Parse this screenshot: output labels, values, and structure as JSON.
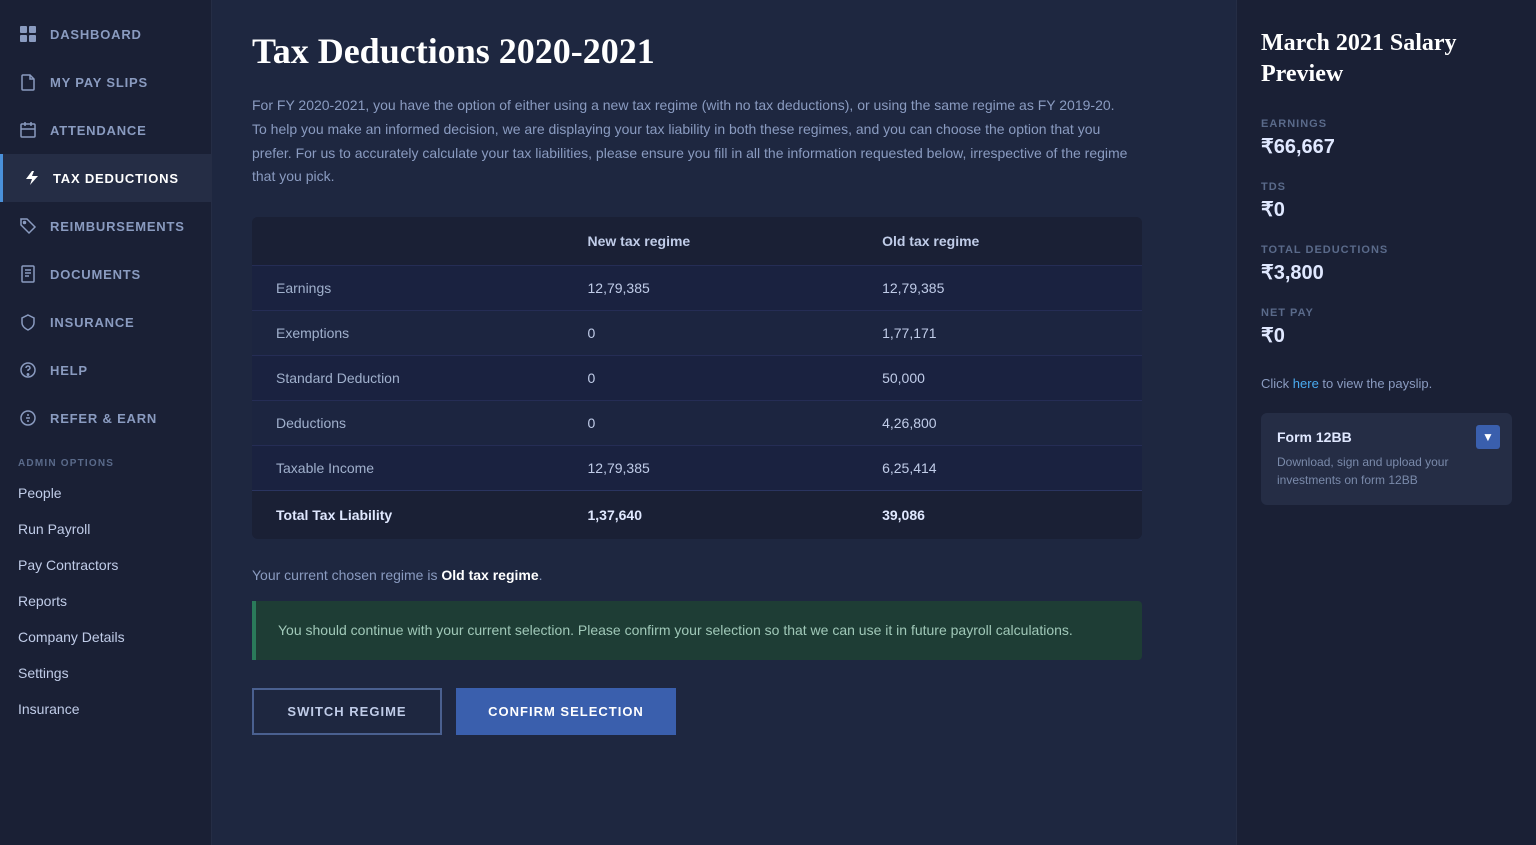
{
  "sidebar": {
    "nav_items": [
      {
        "id": "dashboard",
        "label": "DASHBOARD",
        "icon": "grid"
      },
      {
        "id": "my-pay-slips",
        "label": "MY PAY SLIPS",
        "icon": "file"
      },
      {
        "id": "attendance",
        "label": "ATTENDANCE",
        "icon": "calendar"
      },
      {
        "id": "tax-deductions",
        "label": "TAX DEDUCTIONS",
        "icon": "bolt",
        "active": true
      },
      {
        "id": "reimbursements",
        "label": "REIMBURSEMENTS",
        "icon": "tag"
      },
      {
        "id": "documents",
        "label": "DOCUMENTS",
        "icon": "doc"
      },
      {
        "id": "insurance",
        "label": "INSURANCE",
        "icon": "shield"
      },
      {
        "id": "help",
        "label": "HELP",
        "icon": "question"
      },
      {
        "id": "refer-earn",
        "label": "REFER & EARN",
        "icon": "coin"
      }
    ],
    "admin_section_label": "ADMIN OPTIONS",
    "admin_items": [
      {
        "id": "people",
        "label": "People"
      },
      {
        "id": "run-payroll",
        "label": "Run Payroll"
      },
      {
        "id": "pay-contractors",
        "label": "Pay Contractors"
      },
      {
        "id": "reports",
        "label": "Reports"
      },
      {
        "id": "company-details",
        "label": "Company Details"
      },
      {
        "id": "settings",
        "label": "Settings"
      },
      {
        "id": "insurance-admin",
        "label": "Insurance"
      }
    ]
  },
  "main": {
    "title": "Tax Deductions 2020-2021",
    "description": "For FY 2020-2021, you have the option of either using a new tax regime (with no tax deductions), or using the same regime as FY 2019-20. To help you make an informed decision, we are displaying your tax liability in both these regimes, and you can choose the option that you prefer. For us to accurately calculate your tax liabilities, please ensure you fill in all the information requested below, irrespective of the regime that you pick.",
    "table": {
      "columns": [
        "",
        "New tax regime",
        "Old tax regime"
      ],
      "rows": [
        {
          "label": "Earnings",
          "new_regime": "12,79,385",
          "old_regime": "12,79,385"
        },
        {
          "label": "Exemptions",
          "new_regime": "0",
          "old_regime": "1,77,171"
        },
        {
          "label": "Standard Deduction",
          "new_regime": "0",
          "old_regime": "50,000"
        },
        {
          "label": "Deductions",
          "new_regime": "0",
          "old_regime": "4,26,800"
        },
        {
          "label": "Taxable Income",
          "new_regime": "12,79,385",
          "old_regime": "6,25,414"
        }
      ],
      "footer": {
        "label": "Total Tax Liability",
        "new_regime": "1,37,640",
        "old_regime": "39,086"
      }
    },
    "current_regime_text": "Your current chosen regime is ",
    "current_regime_bold": "Old tax regime",
    "current_regime_end": ".",
    "advice_text": "You should continue with your current selection. Please confirm your selection so that we can use it in future payroll calculations.",
    "btn_switch": "SWITCH REGIME",
    "btn_confirm": "CONFIRM SELECTION"
  },
  "right_panel": {
    "title": "March 2021 Salary Preview",
    "items": [
      {
        "label": "EARNINGS",
        "value": "₹66,667"
      },
      {
        "label": "TDS",
        "value": "₹0"
      },
      {
        "label": "TOTAL DEDUCTIONS",
        "value": "₹3,800"
      },
      {
        "label": "NET PAY",
        "value": "₹0"
      }
    ],
    "payslip_prefix": "Click ",
    "payslip_link_text": "here",
    "payslip_suffix": " to view the payslip.",
    "form_card": {
      "title": "Form 12BB",
      "description": "Download, sign and upload your investments on form 12BB",
      "icon": "download"
    }
  }
}
